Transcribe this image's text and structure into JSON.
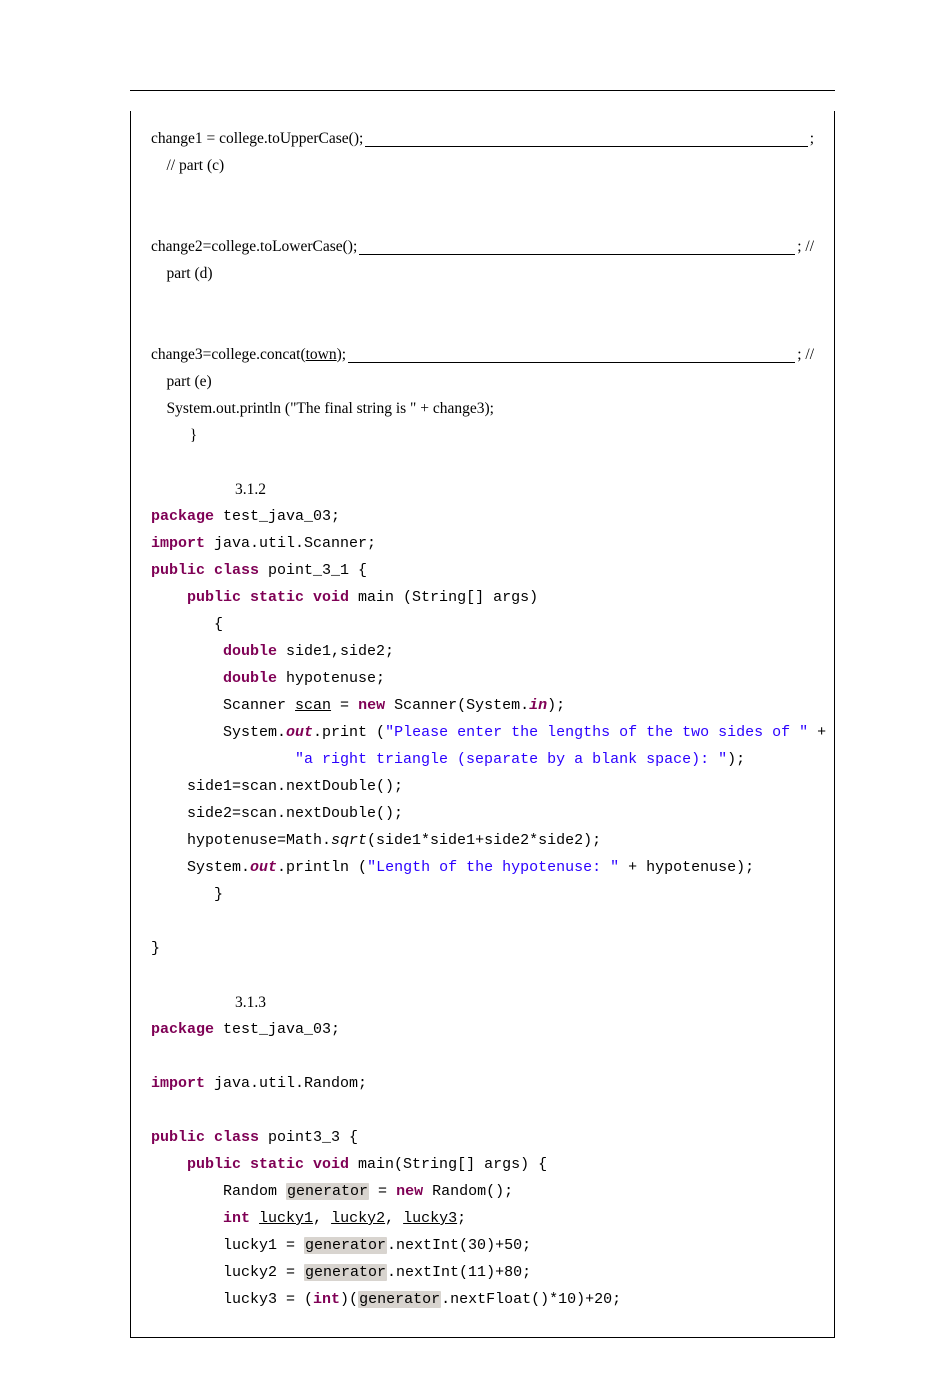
{
  "prose": {
    "line1_left": "               change1 = college.toUpperCase();",
    "line1_right": ";",
    "partc": "    // part (c)",
    "line2_left": "    change2=college.toLowerCase();",
    "line2_right": ";    //",
    "partd": "    part (d)",
    "line3_left": "    change3=college.concat(",
    "line3_town": "town",
    "line3_mid": ");",
    "line3_right": ";    //",
    "parte": "    part (e)",
    "println": "    System.out.println (\"The final string is \" + change3);",
    "brace": "          }"
  },
  "sections": {
    "s312": "3.1.2",
    "s313": "3.1.3"
  },
  "code312": {
    "l01a": "package",
    "l01b": " test_java_03;",
    "l02a": "import",
    "l02b": " java.util.Scanner;",
    "l03a": "public class",
    "l03b": " point_3_1 {",
    "l04a": "    public static void",
    "l04b": " main (String[] args)",
    "l05": "       {",
    "l06a": "        double",
    "l06b": " side1,side2;",
    "l07a": "        double",
    "l07b": " hypotenuse;",
    "l08a": "        Scanner ",
    "l08u": "scan",
    "l08b": " = ",
    "l08c": "new",
    "l08d": " Scanner(System.",
    "l08e": "in",
    "l08f": ");",
    "l09a": "        System.",
    "l09b": "out",
    "l09c": ".print (",
    "l09s": "\"Please enter the lengths of the two sides of \"",
    "l09d": " +",
    "l10a": "                ",
    "l10s": "\"a right triangle (separate by a blank space): \"",
    "l10b": ");",
    "l11": "    side1=scan.nextDouble();",
    "l12": "    side2=scan.nextDouble();",
    "l13a": "    hypotenuse=Math.",
    "l13b": "sqrt",
    "l13c": "(side1*side1+side2*side2);",
    "l14a": "    System.",
    "l14b": "out",
    "l14c": ".println (",
    "l14s": "\"Length of the hypotenuse: \"",
    "l14d": " + hypotenuse);",
    "l15": "       }",
    "l17": "}"
  },
  "code313": {
    "l01a": "package",
    "l01b": " test_java_03;",
    "l03a": "import",
    "l03b": " java.util.Random;",
    "l05a": "public class",
    "l05b": " point3_3 {",
    "l06a": "    public static void",
    "l06b": " main(String[] args) {",
    "l07a": "        Random ",
    "l07h": "generator",
    "l07b": " = ",
    "l07c": "new",
    "l07d": " Random();",
    "l08a": "        int",
    "l08b": " ",
    "l08u1": "lucky1",
    "l08c": ", ",
    "l08u2": "lucky2",
    "l08d": ", ",
    "l08u3": "lucky3",
    "l08e": ";",
    "l09a": "        lucky1 = ",
    "l09h": "generator",
    "l09b": ".nextInt(30)+50;",
    "l10a": "        lucky2 = ",
    "l10h": "generator",
    "l10b": ".nextInt(11)+80;",
    "l11a": "        lucky3 = (",
    "l11b": "int",
    "l11c": ")(",
    "l11h": "generator",
    "l11d": ".nextFloat()*10)+20;"
  }
}
